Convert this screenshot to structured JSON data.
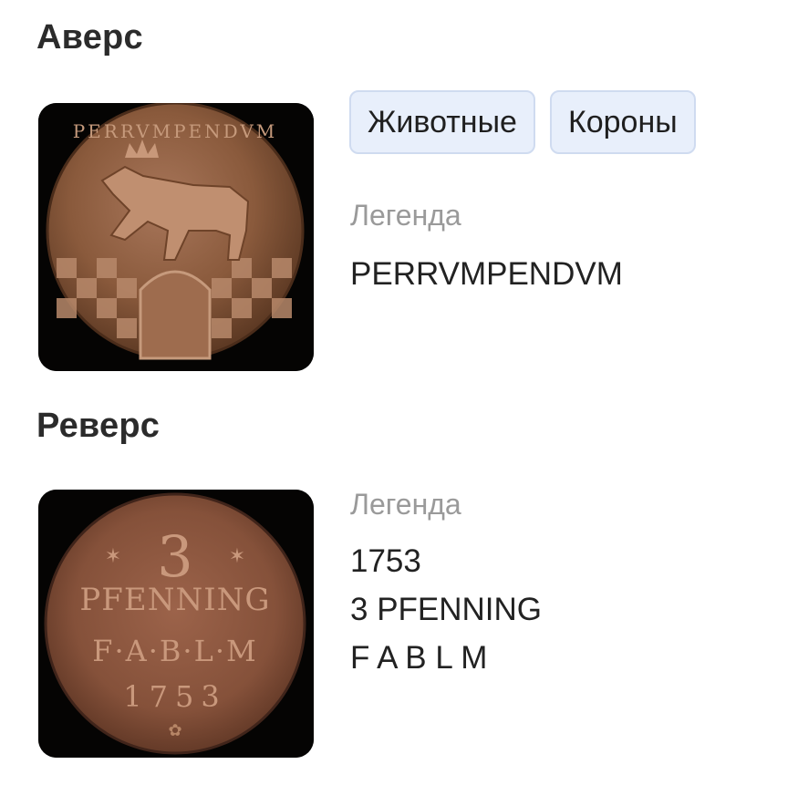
{
  "obverse": {
    "title": "Аверс",
    "tags": [
      "Животные",
      "Короны"
    ],
    "legend_label": "Легенда",
    "legend_text": "PERRVMPENDVM"
  },
  "reverse": {
    "title": "Реверс",
    "legend_label": "Легенда",
    "legend_lines": [
      "1753",
      "3 PFENNING",
      "F A B L M"
    ]
  },
  "colors": {
    "tag_background": "#e8effb",
    "tag_border": "#cfdbf0",
    "label_gray": "#9a9a9a",
    "coin_copper": "#8a5a3c"
  }
}
